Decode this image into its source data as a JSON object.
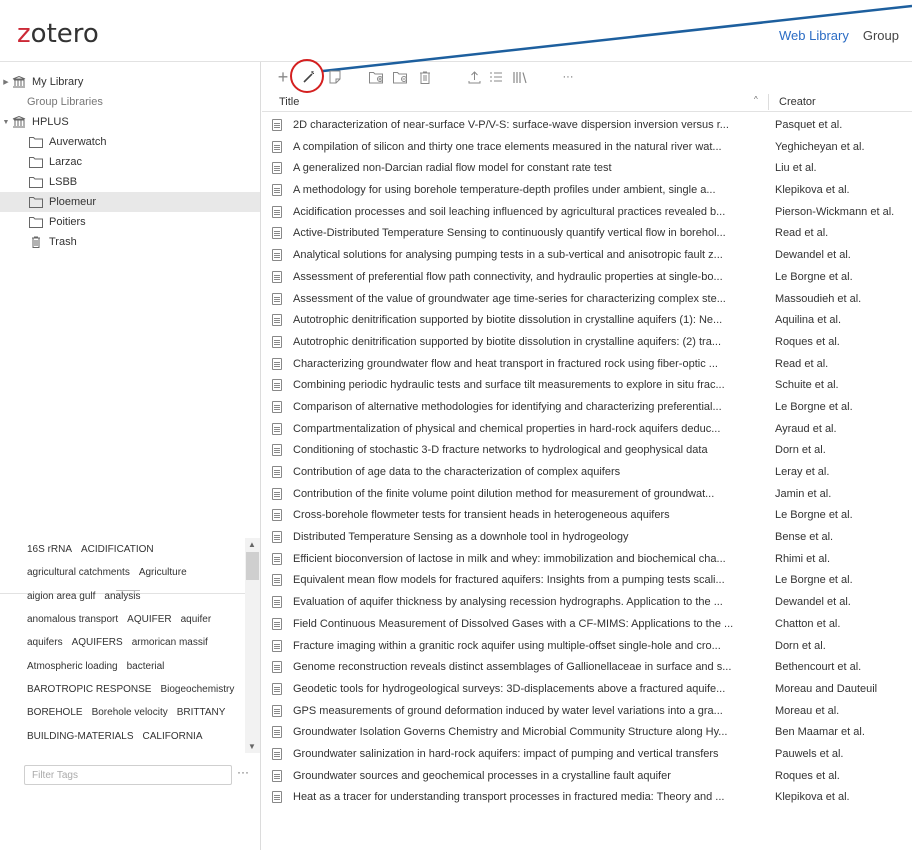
{
  "app": {
    "logo_prefix": "z",
    "logo_rest": "otero",
    "nav_active": "Web Library",
    "nav_other": "Group"
  },
  "colors": {
    "accent": "#2b6cc4",
    "logo": "#cc2936",
    "highlight_circle": "#d42020",
    "selected_row": "#e8e8e8"
  },
  "sidebar": {
    "my_library": "My Library",
    "group_libraries": "Group Libraries",
    "group": "HPLUS",
    "collections": [
      "Auverwatch",
      "Larzac",
      "LSBB",
      "Ploemeur",
      "Poitiers"
    ],
    "selected_collection": "Ploemeur",
    "trash": "Trash"
  },
  "tags": {
    "lines": [
      [
        "16S rRNA",
        "ACIDIFICATION"
      ],
      [
        "agricultural catchments",
        "Agriculture"
      ],
      [
        "aigion area gulf",
        "analysis"
      ],
      [
        "anomalous transport",
        "AQUIFER",
        "aquifer"
      ],
      [
        "aquifers",
        "AQUIFERS",
        "armorican massif"
      ],
      [
        "Atmospheric loading",
        "bacterial"
      ],
      [
        "BAROTROPIC RESPONSE",
        "Biogeochemistry"
      ],
      [
        "BOREHOLE",
        "Borehole velocity",
        "BRITTANY"
      ],
      [
        "BUILDING-MATERIALS",
        "CALIFORNIA"
      ]
    ],
    "filter_placeholder": "Filter Tags",
    "more": "···"
  },
  "toolbar": {
    "icons": [
      "new-item-icon",
      "add-by-identifier-icon",
      "new-note-icon",
      "new-collection-icon",
      "remove-collection-icon",
      "trash-icon",
      "export-icon",
      "bibliography-icon",
      "library-icon",
      "more-icon"
    ],
    "more": "···"
  },
  "columns": {
    "title": "Title",
    "creator": "Creator",
    "sort": "^"
  },
  "items": [
    {
      "title": "2D characterization of near-surface V-P/V-S: surface-wave dispersion inversion versus r...",
      "creator": "Pasquet et al."
    },
    {
      "title": "A compilation of silicon and thirty one trace elements measured in the natural river wat...",
      "creator": "Yeghicheyan et al."
    },
    {
      "title": "A generalized non-Darcian radial flow model for constant rate test",
      "creator": "Liu et al."
    },
    {
      "title": "A methodology for using borehole temperature-depth profiles under ambient, single a...",
      "creator": "Klepikova et al."
    },
    {
      "title": "Acidification processes and soil leaching influenced by agricultural practices revealed b...",
      "creator": "Pierson-Wickmann et al."
    },
    {
      "title": "Active-Distributed Temperature Sensing to continuously quantify vertical flow in borehol...",
      "creator": "Read et al."
    },
    {
      "title": "Analytical solutions for analysing pumping tests in a sub-vertical and anisotropic fault z...",
      "creator": "Dewandel et al."
    },
    {
      "title": "Assessment of preferential flow path connectivity, and hydraulic properties at single-bo...",
      "creator": "Le Borgne et al."
    },
    {
      "title": "Assessment of the value of groundwater age time-series for characterizing complex ste...",
      "creator": "Massoudieh et al."
    },
    {
      "title": "Autotrophic denitrification supported by biotite dissolution in crystalline aquifers (1): Ne...",
      "creator": "Aquilina et al."
    },
    {
      "title": "Autotrophic denitrification supported by biotite dissolution in crystalline aquifers: (2) tra...",
      "creator": "Roques et al."
    },
    {
      "title": "Characterizing groundwater flow and heat transport in fractured rock using fiber-optic ...",
      "creator": "Read et al."
    },
    {
      "title": "Combining periodic hydraulic tests and surface tilt measurements to explore in situ frac...",
      "creator": "Schuite et al."
    },
    {
      "title": "Comparison of alternative methodologies for identifying and characterizing preferential...",
      "creator": "Le Borgne et al."
    },
    {
      "title": "Compartmentalization of physical and chemical properties in hard-rock aquifers deduc...",
      "creator": "Ayraud et al."
    },
    {
      "title": "Conditioning of stochastic 3-D fracture networks to hydrological and geophysical data",
      "creator": "Dorn et al."
    },
    {
      "title": "Contribution of age data to the characterization of complex aquifers",
      "creator": "Leray et al."
    },
    {
      "title": "Contribution of the finite volume point dilution method for measurement of groundwat...",
      "creator": "Jamin et al."
    },
    {
      "title": "Cross-borehole flowmeter tests for transient heads in heterogeneous aquifers",
      "creator": "Le Borgne et al."
    },
    {
      "title": "Distributed Temperature Sensing as a downhole tool in hydrogeology",
      "creator": "Bense et al."
    },
    {
      "title": "Efficient bioconversion of lactose in milk and whey: immobilization and biochemical cha...",
      "creator": "Rhimi et al."
    },
    {
      "title": "Equivalent mean flow models for fractured aquifers: Insights from a pumping tests scali...",
      "creator": "Le Borgne et al."
    },
    {
      "title": "Evaluation of aquifer thickness by analysing recession hydrographs. Application to the ...",
      "creator": "Dewandel et al."
    },
    {
      "title": "Field Continuous Measurement of Dissolved Gases with a CF-MIMS: Applications to the ...",
      "creator": "Chatton et al."
    },
    {
      "title": "Fracture imaging within a granitic rock aquifer using multiple-offset single-hole and cro...",
      "creator": "Dorn et al."
    },
    {
      "title": "Genome reconstruction reveals distinct assemblages of Gallionellaceae in surface and s...",
      "creator": "Bethencourt et al."
    },
    {
      "title": "Geodetic tools for hydrogeological surveys: 3D-displacements above a fractured aquife...",
      "creator": "Moreau and Dauteuil"
    },
    {
      "title": "GPS measurements of ground deformation induced by water level variations into a gra...",
      "creator": "Moreau et al."
    },
    {
      "title": "Groundwater Isolation Governs Chemistry and Microbial Community Structure along Hy...",
      "creator": "Ben Maamar et al."
    },
    {
      "title": "Groundwater salinization in hard-rock aquifers: impact of pumping and vertical transfers",
      "creator": "Pauwels et al."
    },
    {
      "title": "Groundwater sources and geochemical processes in a crystalline fault aquifer",
      "creator": "Roques et al."
    },
    {
      "title": "Heat as a tracer for understanding transport processes in fractured media: Theory and ...",
      "creator": "Klepikova et al."
    }
  ]
}
